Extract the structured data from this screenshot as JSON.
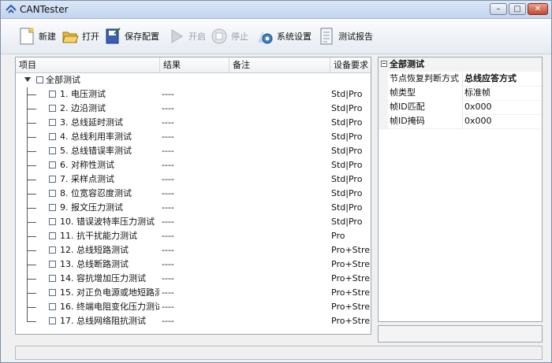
{
  "window": {
    "title": "CANTester",
    "min_glyph": "–",
    "max_glyph": "□",
    "close_glyph": "✕"
  },
  "toolbar": {
    "new_label": "新建",
    "open_label": "打开",
    "save_config_label": "保存配置",
    "start_label": "开启",
    "stop_label": "停止",
    "settings_label": "系统设置",
    "report_label": "测试报告"
  },
  "table": {
    "columns": [
      "项目",
      "结果",
      "备注",
      "设备要求"
    ],
    "root_label": "全部测试",
    "rows": [
      {
        "name": "1. 电压测试",
        "result": "----",
        "req": "Std|Pro"
      },
      {
        "name": "2. 边沿测试",
        "result": "----",
        "req": "Std|Pro"
      },
      {
        "name": "3. 总线延时测试",
        "result": "----",
        "req": "Std|Pro"
      },
      {
        "name": "4. 总线利用率测试",
        "result": "----",
        "req": "Std|Pro"
      },
      {
        "name": "5. 总线错误率测试",
        "result": "----",
        "req": "Std|Pro"
      },
      {
        "name": "6. 对称性测试",
        "result": "----",
        "req": "Std|Pro"
      },
      {
        "name": "7. 采样点测试",
        "result": "----",
        "req": "Std|Pro"
      },
      {
        "name": "8. 位宽容忍度测试",
        "result": "----",
        "req": "Std|Pro"
      },
      {
        "name": "9. 报文压力测试",
        "result": "----",
        "req": "Std|Pro"
      },
      {
        "name": "10. 错误波特率压力测试",
        "result": "----",
        "req": "Std|Pro"
      },
      {
        "name": "11. 抗干扰能力测试",
        "result": "----",
        "req": "Pro"
      },
      {
        "name": "12. 总线短路测试",
        "result": "----",
        "req": "Pro+Stre..."
      },
      {
        "name": "13. 总线断路测试",
        "result": "----",
        "req": "Pro+Stre..."
      },
      {
        "name": "14. 容抗增加压力测试",
        "result": "----",
        "req": "Pro+Stre..."
      },
      {
        "name": "15. 对正负电源或地短路测...",
        "result": "----",
        "req": "Pro+Stre..."
      },
      {
        "name": "16. 终端电阻变化压力测试",
        "result": "----",
        "req": "Pro+Stre..."
      },
      {
        "name": "17. 总线网络阻抗测试",
        "result": "----",
        "req": "Pro+Stre..."
      }
    ]
  },
  "properties": {
    "category": "全部测试",
    "items": [
      {
        "name": "节点恢复判断方式",
        "value": "总线应答方式",
        "bold": true
      },
      {
        "name": "帧类型",
        "value": "标准帧",
        "bold": false
      },
      {
        "name": "帧ID匹配",
        "value": "0x000",
        "bold": false
      },
      {
        "name": "帧ID掩码",
        "value": "0x000",
        "bold": false
      }
    ]
  }
}
